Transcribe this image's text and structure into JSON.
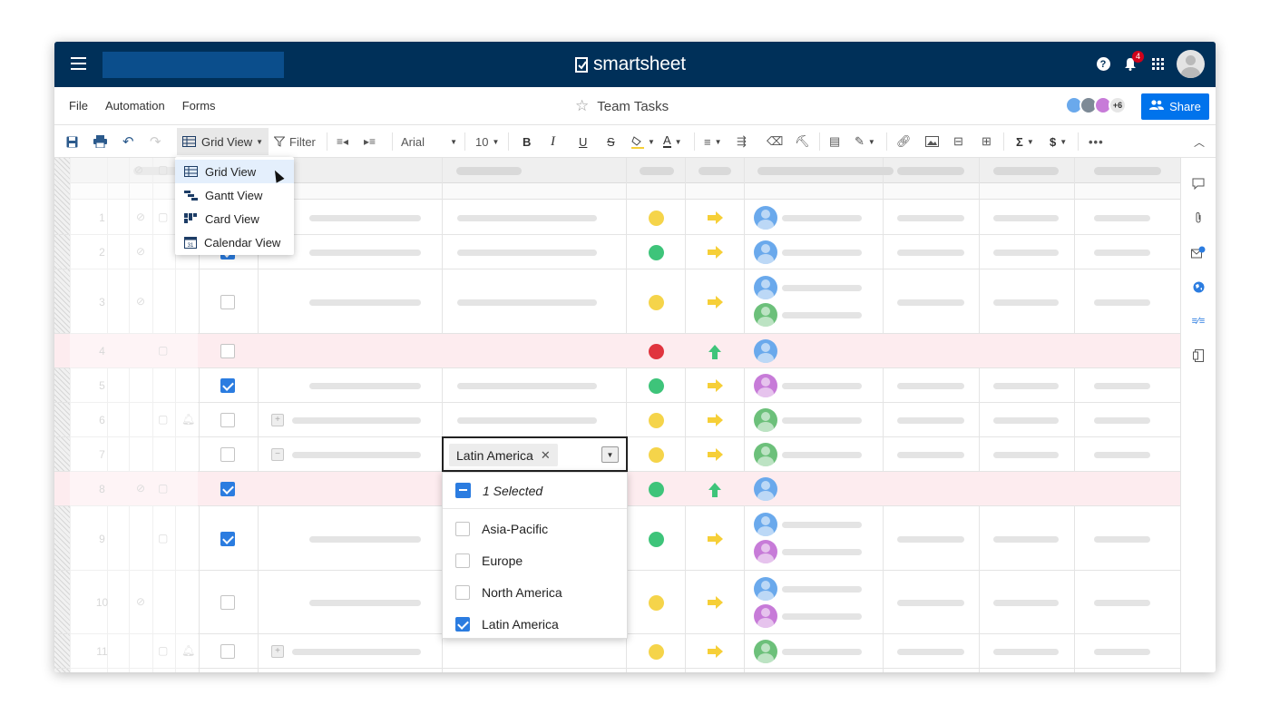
{
  "app": {
    "logo_text": "smartsheet",
    "notification_count": "4"
  },
  "menu": {
    "items": [
      "File",
      "Automation",
      "Forms"
    ]
  },
  "sheet": {
    "title": "Team Tasks",
    "collaborators_more": "+6",
    "share_label": "Share"
  },
  "toolbar": {
    "view_label": "Grid View",
    "filter_label": "Filter",
    "font_label": "Arial",
    "size_label": "10"
  },
  "view_menu": {
    "items": [
      "Grid View",
      "Gantt View",
      "Card View",
      "Calendar View"
    ],
    "selected": "Grid View"
  },
  "rows": [
    "1",
    "2",
    "3",
    "4",
    "5",
    "6",
    "7",
    "8",
    "9",
    "10",
    "11"
  ],
  "cell_editor": {
    "chip_label": "Latin America"
  },
  "region_dropdown": {
    "summary": "1 Selected",
    "options": [
      "Asia-Pacific",
      "Europe",
      "North America",
      "Latin America"
    ],
    "checked": [
      "Latin America"
    ]
  },
  "colors": {
    "topbar": "#003059",
    "share": "#0073ec",
    "status_green": "#3ec47a",
    "status_yellow": "#f5d44a",
    "status_red": "#e0343e",
    "arrow_yellow": "#f6cf37",
    "arrow_green": "#3ec47a",
    "accent": "#2b7ce0"
  }
}
